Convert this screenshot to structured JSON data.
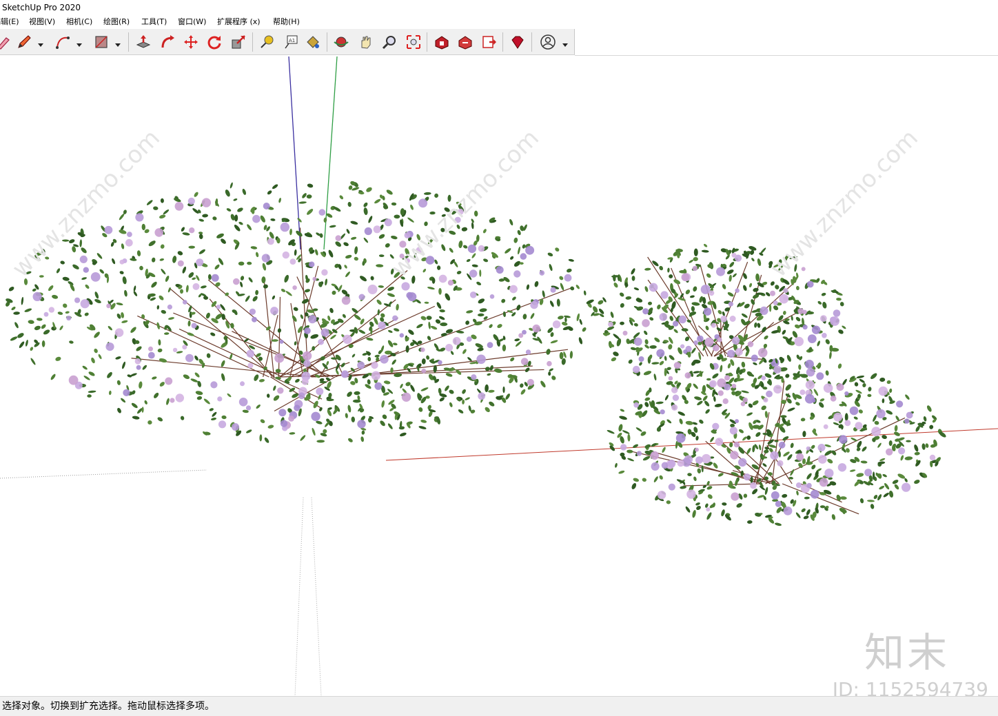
{
  "window": {
    "title": "SketchUp Pro 2020"
  },
  "menu": [
    {
      "label": "编辑(E)"
    },
    {
      "label": "视图(V)"
    },
    {
      "label": "相机(C)"
    },
    {
      "label": "绘图(R)"
    },
    {
      "label": "工具(T)"
    },
    {
      "label": "窗口(W)"
    },
    {
      "label": "扩展程序 (x)"
    },
    {
      "label": "帮助(H)"
    }
  ],
  "toolbar": {
    "tools": [
      "eraser-icon",
      "pencil-icon",
      "arc-icon",
      "shape-icon",
      "push-pull-icon",
      "follow-me-icon",
      "move-icon",
      "rotate-icon",
      "scale-icon",
      "tape-measure-icon",
      "text-icon",
      "paint-bucket-icon",
      "orbit-icon",
      "pan-icon",
      "zoom-icon",
      "zoom-extents-icon",
      "warehouse-icon",
      "extension-warehouse-icon",
      "layout-icon",
      "ruby-icon",
      "account-icon"
    ]
  },
  "colors": {
    "axis_red": "#c0392b",
    "axis_green": "#2e9e44",
    "axis_blue": "#3a2fa0",
    "leaf": "#3f6b2a",
    "flower": "#b79ad8"
  },
  "watermark": {
    "site": "www.znzmo.com",
    "logo": "知末",
    "id": "ID: 1152594739"
  },
  "status": {
    "text": "选择对象。切换到扩充选择。拖动鼠标选择多项。"
  }
}
